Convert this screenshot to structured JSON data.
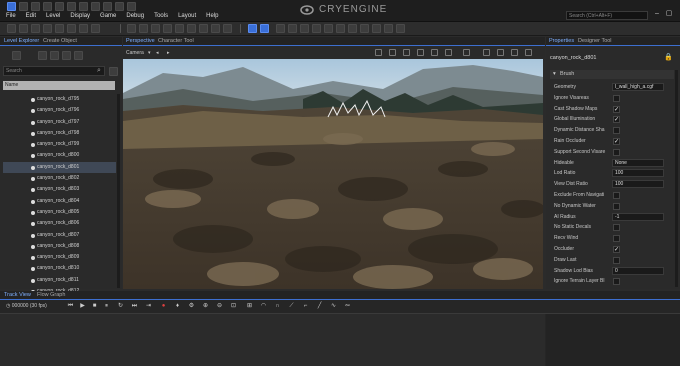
{
  "menu": [
    "File",
    "Edit",
    "Level",
    "Display",
    "Game",
    "Debug",
    "Tools",
    "Layout",
    "Help"
  ],
  "brand": "CRYENGINE",
  "search_placeholder": "Search (Ctrl+Alt+F)",
  "left_panel": {
    "tabs": [
      "Level Explorer",
      "Create Object"
    ],
    "search_placeholder": "Search",
    "column": "Name",
    "items": [
      "canyon_rock_d795",
      "canyon_rock_d796",
      "canyon_rock_d797",
      "canyon_rock_d798",
      "canyon_rock_d799",
      "canyon_rock_d800",
      "canyon_rock_d801",
      "canyon_rock_d802",
      "canyon_rock_d803",
      "canyon_rock_d804",
      "canyon_rock_d805",
      "canyon_rock_d806",
      "canyon_rock_d807",
      "canyon_rock_d808",
      "canyon_rock_d809",
      "canyon_rock_d810",
      "canyon_rock_d811",
      "canyon_rock_d812",
      "canyon_rock_d813"
    ],
    "selected_index": 6
  },
  "viewport": {
    "tabs": [
      "Perspective",
      "Character Tool"
    ],
    "camera_label": "Camera"
  },
  "properties": {
    "tabs": [
      "Properties",
      "Designer Tool"
    ],
    "object_name": "canyon_rock_d801",
    "section": "Brush",
    "rows": [
      {
        "label": "Geometry",
        "type": "text",
        "value": "l_wall_high_a.cgf"
      },
      {
        "label": "Ignore Visareas",
        "type": "check",
        "checked": false
      },
      {
        "label": "Cast Shadow Maps",
        "type": "check",
        "checked": true
      },
      {
        "label": "Global Illumination",
        "type": "check",
        "checked": true
      },
      {
        "label": "Dynamic Distance Sha",
        "type": "check",
        "checked": false
      },
      {
        "label": "Rain Occluder",
        "type": "check",
        "checked": true
      },
      {
        "label": "Support Second Visare",
        "type": "check",
        "checked": false
      },
      {
        "label": "Hideable",
        "type": "text",
        "value": "None"
      },
      {
        "label": "Lod Ratio",
        "type": "text",
        "value": "100"
      },
      {
        "label": "View Dist Ratio",
        "type": "text",
        "value": "100"
      },
      {
        "label": "Exclude From Navigati",
        "type": "check",
        "checked": false
      },
      {
        "label": "No Dynamic Water",
        "type": "check",
        "checked": false
      },
      {
        "label": "AI Radius",
        "type": "text",
        "value": "-1"
      },
      {
        "label": "No Static Decals",
        "type": "check",
        "checked": false
      },
      {
        "label": "Recv Wind",
        "type": "check",
        "checked": false
      },
      {
        "label": "Occluder",
        "type": "check",
        "checked": true
      },
      {
        "label": "Draw Last",
        "type": "check",
        "checked": false
      },
      {
        "label": "Shadow Lod Bias",
        "type": "text",
        "value": "0"
      },
      {
        "label": "Ignore Terrain Layer Bl",
        "type": "check",
        "checked": false
      }
    ]
  },
  "track": {
    "tabs": [
      "Track View",
      "Flow Graph"
    ],
    "time": "000000 (30 fps)"
  },
  "colors": {
    "accent": "#3d6fd0",
    "selected": "#3f4856"
  }
}
